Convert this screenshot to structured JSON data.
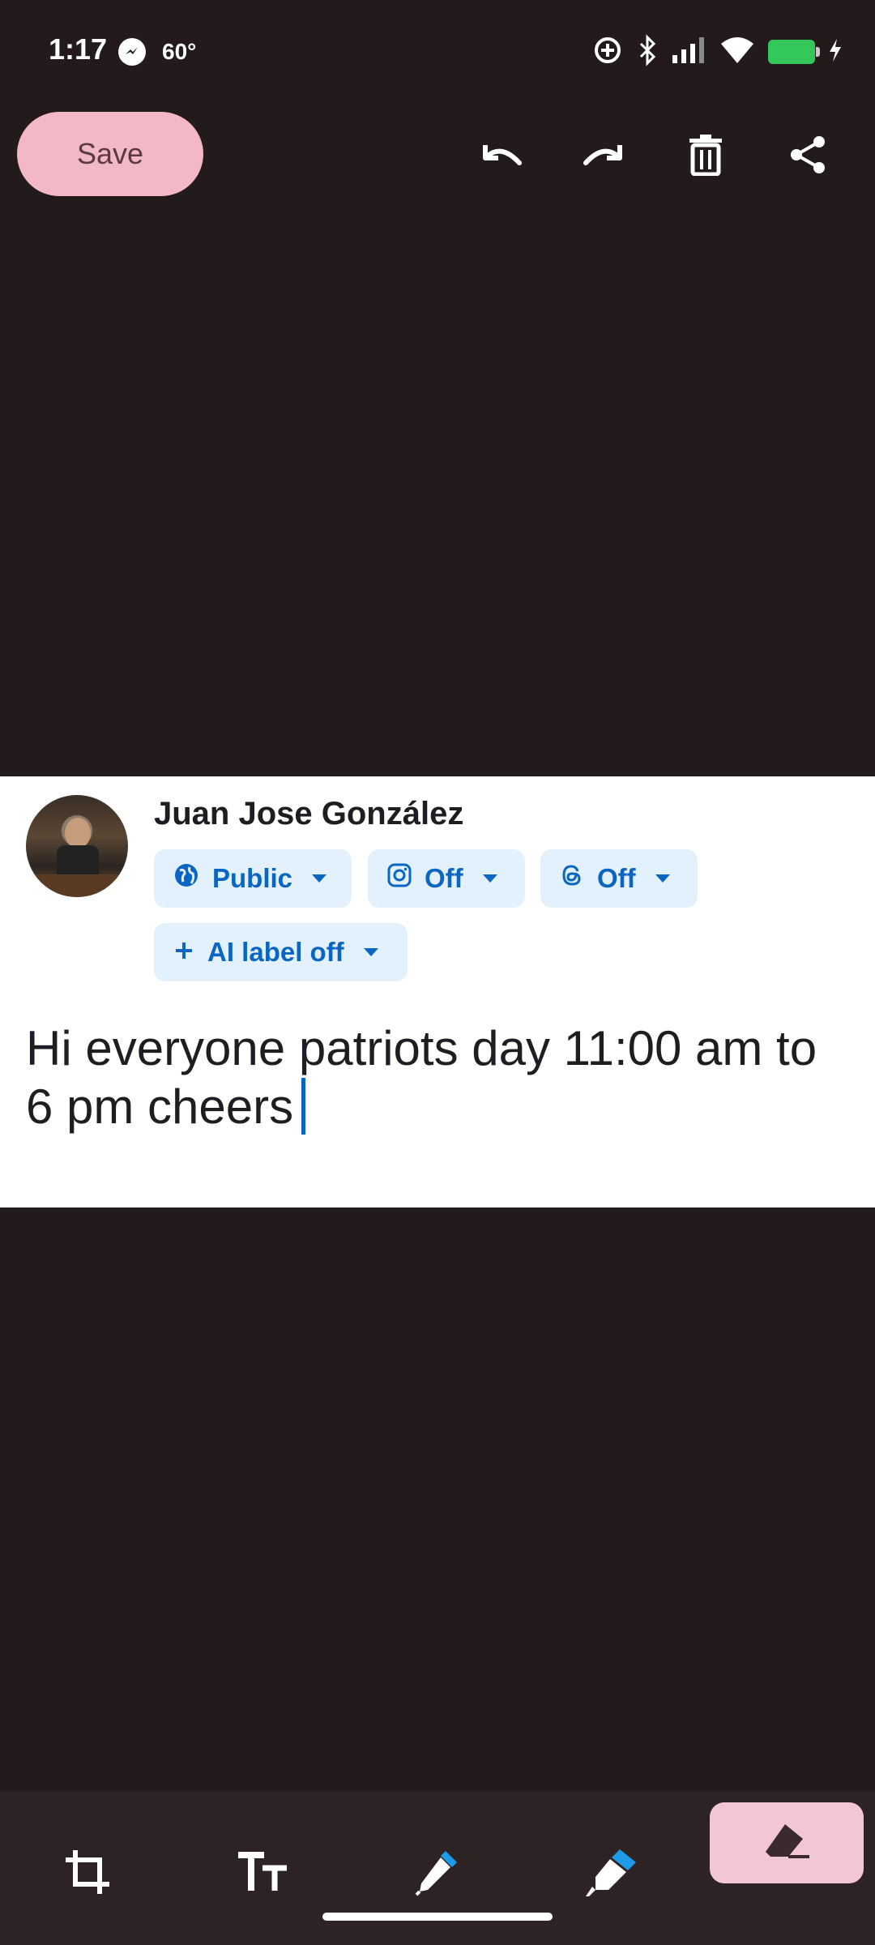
{
  "status_bar": {
    "time": "1:17",
    "temperature": "60°",
    "icons": [
      "messenger-icon",
      "data-saver-icon",
      "bluetooth-icon",
      "signal-icon",
      "wifi-icon",
      "battery-charging-icon"
    ]
  },
  "toolbar": {
    "save_label": "Save",
    "icons": [
      "undo-icon",
      "redo-icon",
      "trash-icon",
      "share-icon"
    ]
  },
  "post": {
    "username": "Juan Jose González",
    "audience_chip": "Public",
    "instagram_chip": "Off",
    "threads_chip": "Off",
    "ai_label_chip": "AI label off",
    "text": "Hi everyone patriots day 11:00 am to 6 pm cheers"
  },
  "bottom_tools": {
    "icons": [
      "crop-icon",
      "text-size-icon",
      "pen-icon",
      "marker-icon",
      "eraser-icon"
    ],
    "selected": "eraser-icon"
  },
  "colors": {
    "background": "#231a1b",
    "accent_pink": "#f2b8c6",
    "chip_bg": "#e3f1fd",
    "chip_text": "#0a66c2",
    "brush_blue": "#1e9be8"
  }
}
